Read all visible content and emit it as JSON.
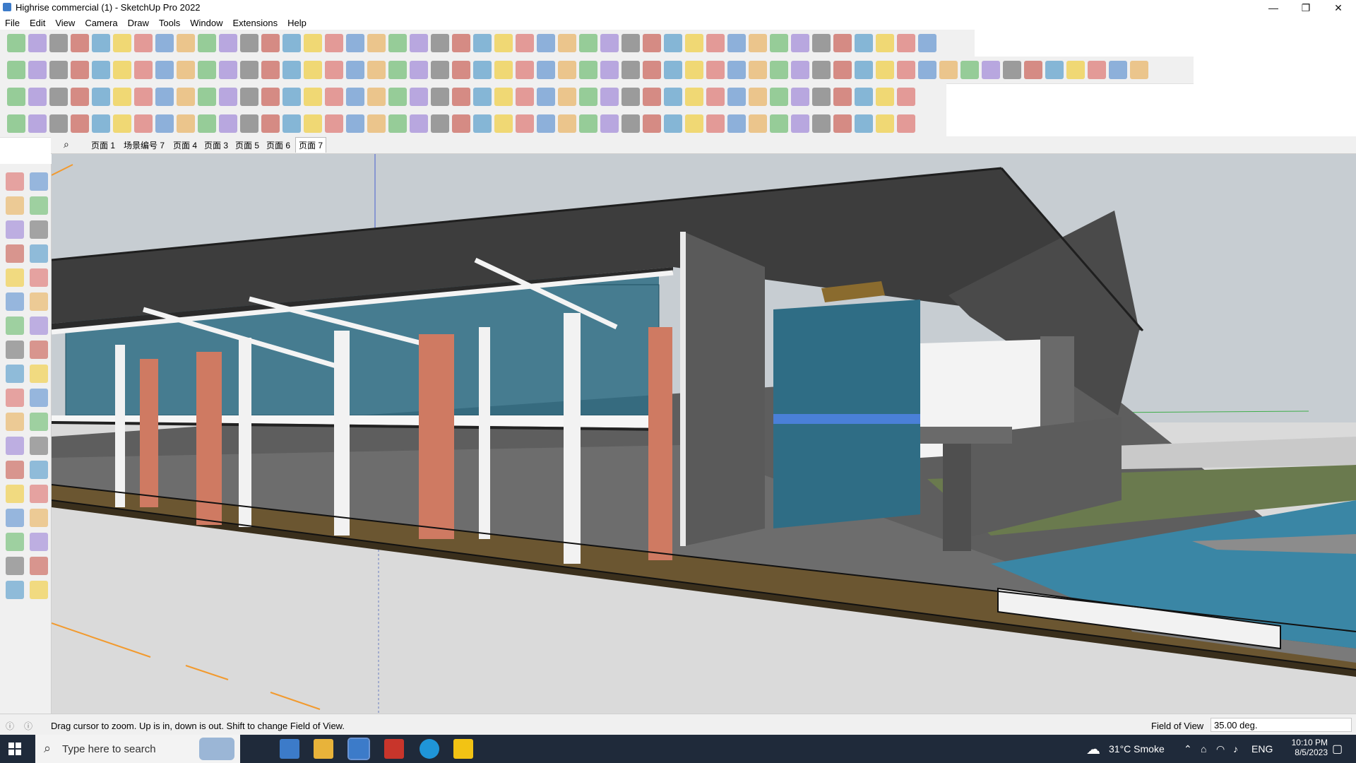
{
  "window": {
    "title": "Highrise commercial (1) - SketchUp Pro 2022",
    "controls": [
      "—",
      "❐",
      "✕"
    ]
  },
  "menu": [
    "File",
    "Edit",
    "View",
    "Camera",
    "Draw",
    "Tools",
    "Window",
    "Extensions",
    "Help"
  ],
  "scenes": {
    "tabs": [
      "页面 1",
      "场景编号 7",
      "页面 4",
      "页面 3",
      "页面 5",
      "页面 6",
      "页面 7"
    ],
    "active_index": 6
  },
  "statusbar": {
    "message": "Drag cursor to zoom.  Up is in, down is out. Shift to change Field of View.",
    "fov_label": "Field of View",
    "fov_value": "35.00 deg."
  },
  "taskbar": {
    "search_placeholder": "Type here to search",
    "weather": "31°C  Smoke",
    "language": "ENG",
    "time": "10:10 PM",
    "date": "8/5/2023"
  },
  "colors": {
    "roof": "#3d3d3d",
    "floor": "#6f6f6f",
    "earth": "#6b5631",
    "glass": "#2f6d85",
    "brick": "#5a5a5a",
    "terracotta": "#cf7a62",
    "water": "#3a86a5",
    "axis": "#f29a2e"
  }
}
